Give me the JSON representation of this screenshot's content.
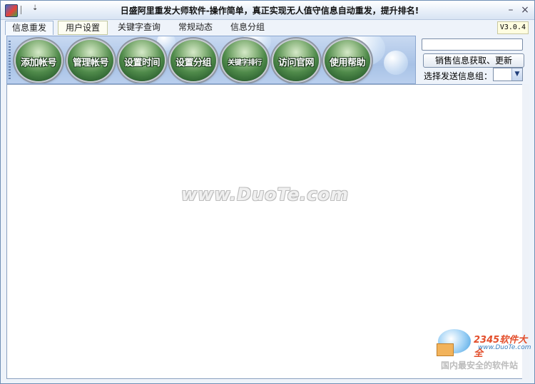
{
  "window": {
    "title": "日盛阿里重发大师软件-操作简单，真正实现无人值守信息自动重发，提升排名!",
    "quick_access_glyph": "⇣",
    "minimize_glyph": "–",
    "close_glyph": "×"
  },
  "tabs": [
    {
      "label": "信息重发"
    },
    {
      "label": "用户设置"
    },
    {
      "label": "关键字查询"
    },
    {
      "label": "常规动态"
    },
    {
      "label": "信息分组"
    }
  ],
  "version": "V3.0.4",
  "toolbar": [
    {
      "label": "添加帐号",
      "icon": "add-account-icon"
    },
    {
      "label": "管理帐号",
      "icon": "manage-account-icon"
    },
    {
      "label": "设置时间",
      "icon": "set-time-icon"
    },
    {
      "label": "设置分组",
      "icon": "set-group-icon"
    },
    {
      "label": "关键字排行",
      "icon": "keyword-rank-icon"
    },
    {
      "label": "访问官网",
      "icon": "visit-site-icon"
    },
    {
      "label": "使用帮助",
      "icon": "help-icon"
    }
  ],
  "right_panel": {
    "input_value": "",
    "fetch_button": "销售信息获取、更新",
    "group_label": "选择发送信息组：",
    "group_value": ""
  },
  "watermark": "www.DuoTe.com",
  "logo": {
    "brand": "2345软件大全",
    "url": "www.DuoTe.com",
    "slogan": "国内最安全的软件站"
  },
  "colors": {
    "accent": "#2f6432",
    "frame": "#6f8fb5",
    "toolbar_bg": "#a8c2e6"
  }
}
